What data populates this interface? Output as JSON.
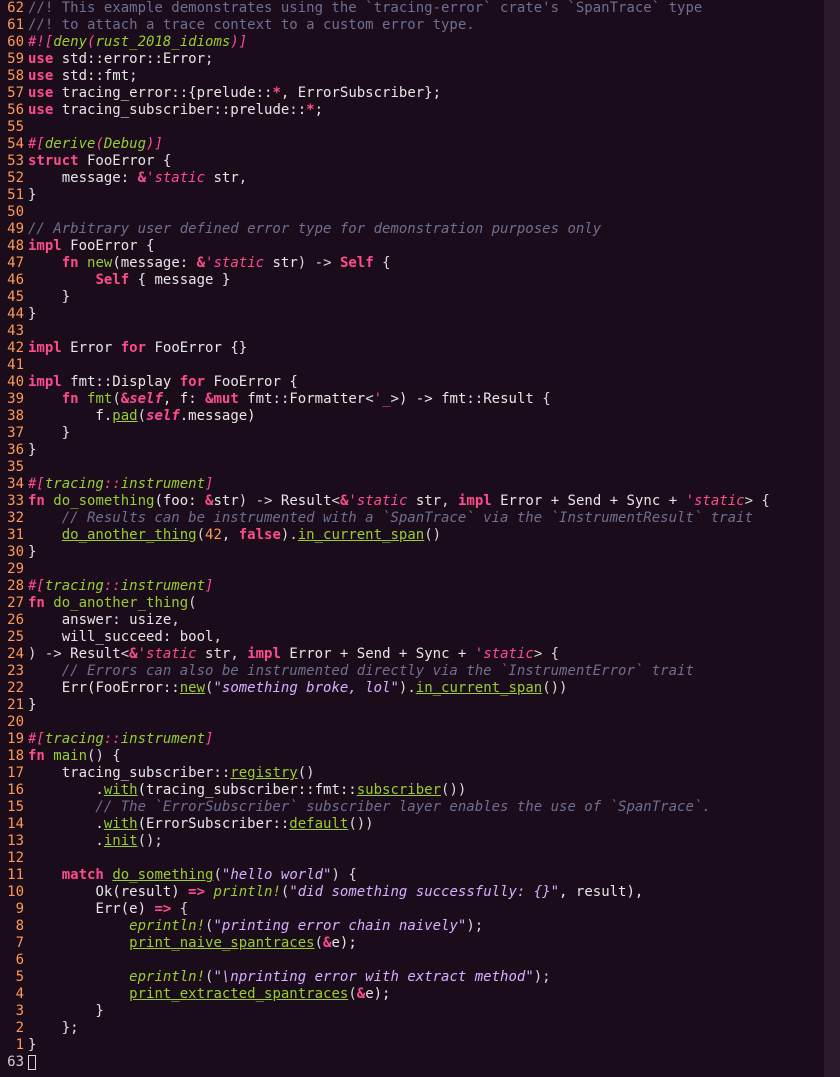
{
  "gutter": {
    "relnums": [
      62,
      61,
      60,
      59,
      58,
      57,
      56,
      55,
      54,
      53,
      52,
      51,
      50,
      49,
      48,
      47,
      46,
      45,
      44,
      43,
      42,
      41,
      40,
      39,
      38,
      37,
      36,
      35,
      34,
      33,
      32,
      31,
      30,
      29,
      28,
      27,
      26,
      25,
      24,
      23,
      22,
      21,
      20,
      19,
      18,
      17,
      16,
      15,
      14,
      13,
      12,
      11,
      10,
      9,
      8,
      7,
      6,
      5,
      4,
      3,
      2,
      1
    ],
    "status": "63"
  },
  "code": {
    "l1": "//! This example demonstrates using the `tracing-error` crate's `SpanTrace` type",
    "l2": "//! to attach a trace context to a custom error type.",
    "l3a": "#![",
    "l3b": "deny",
    "l3c": "(",
    "l3d": "rust_2018_idioms",
    "l3e": ")]",
    "l4a": "use",
    "l4b": " std::error::Error;",
    "l5a": "use",
    "l5b": " std::fmt;",
    "l6a": "use",
    "l6b": " tracing_error::{prelude::",
    "l6c": "*",
    "l6d": ", ErrorSubscriber};",
    "l7a": "use",
    "l7b": " tracing_subscriber::prelude::",
    "l7c": "*",
    "l7d": ";",
    "l9a": "#[",
    "l9b": "derive",
    "l9c": "(",
    "l9d": "Debug",
    "l9e": ")]",
    "l10a": "struct",
    "l10b": " FooError {",
    "l11a": "    message: ",
    "l11b": "&",
    "l11c": "'static",
    "l11d": " str",
    "l11e": ",",
    "l12": "}",
    "l14": "// Arbitrary user defined error type for demonstration purposes only",
    "l15a": "impl",
    "l15b": " FooError {",
    "l16a": "    ",
    "l16b": "fn",
    "l16c": " ",
    "l16d": "new",
    "l16e": "(message: ",
    "l16f": "&",
    "l16g": "'static",
    "l16h": " str",
    "l16i": ") -> ",
    "l16j": "Self",
    "l16k": " {",
    "l17a": "        ",
    "l17b": "Self",
    "l17c": " { message }",
    "l18": "    }",
    "l19": "}",
    "l21a": "impl",
    "l21b": " Error ",
    "l21c": "for",
    "l21d": " FooError {}",
    "l23a": "impl",
    "l23b": " fmt::Display ",
    "l23c": "for",
    "l23d": " FooError {",
    "l24a": "    ",
    "l24b": "fn",
    "l24c": " ",
    "l24d": "fmt",
    "l24e": "(",
    "l24f": "&",
    "l24g": "self",
    "l24h": ", f: ",
    "l24i": "&",
    "l24j": "mut",
    "l24k": " fmt::Formatter<",
    "l24l": "'_",
    "l24m": ">) -> fmt::",
    "l24n": "Result",
    "l24o": " {",
    "l25a": "        f.",
    "l25b": "pad",
    "l25c": "(",
    "l25d": "self",
    "l25e": ".message)",
    "l26": "    }",
    "l27": "}",
    "l29a": "#[",
    "l29b": "tracing",
    "l29c": "::",
    "l29d": "instrument",
    "l29e": "]",
    "l30a": "fn",
    "l30b": " ",
    "l30c": "do_something",
    "l30d": "(foo: ",
    "l30e": "&",
    "l30f": "str",
    "l30g": ") -> ",
    "l30h": "Result",
    "l30i": "<",
    "l30j": "&",
    "l30k": "'static",
    "l30l": " str",
    "l30m": ", ",
    "l30n": "impl",
    "l30o": " Error + Send + Sync + ",
    "l30p": "'static",
    "l30q": "> {",
    "l31": "    // Results can be instrumented with a `SpanTrace` via the `InstrumentResult` trait",
    "l32a": "    ",
    "l32b": "do_another_thing",
    "l32c": "(",
    "l32d": "42",
    "l32e": ", ",
    "l32f": "false",
    "l32g": ").",
    "l32h": "in_current_span",
    "l32i": "()",
    "l33": "}",
    "l35a": "#[",
    "l35b": "tracing",
    "l35c": "::",
    "l35d": "instrument",
    "l35e": "]",
    "l36a": "fn",
    "l36b": " ",
    "l36c": "do_another_thing",
    "l36d": "(",
    "l37a": "    answer: ",
    "l37b": "usize",
    "l37c": ",",
    "l38a": "    will_succeed: ",
    "l38b": "bool",
    "l38c": ",",
    "l39a": ") -> ",
    "l39b": "Result",
    "l39c": "<",
    "l39d": "&",
    "l39e": "'static",
    "l39f": " str",
    "l39g": ", ",
    "l39h": "impl",
    "l39i": " Error + Send + Sync + ",
    "l39j": "'static",
    "l39k": "> {",
    "l40": "    // Errors can also be instrumented directly via the `InstrumentError` trait",
    "l41a": "    ",
    "l41b": "Err",
    "l41c": "(FooError::",
    "l41d": "new",
    "l41e": "(",
    "l41f": "\"something broke, lol\"",
    "l41g": ").",
    "l41h": "in_current_span",
    "l41i": "())",
    "l42": "}",
    "l44a": "#[",
    "l44b": "tracing",
    "l44c": "::",
    "l44d": "instrument",
    "l44e": "]",
    "l45a": "fn",
    "l45b": " ",
    "l45c": "main",
    "l45d": "() {",
    "l46a": "    tracing_subscriber::",
    "l46b": "registry",
    "l46c": "()",
    "l47a": "        .",
    "l47b": "with",
    "l47c": "(tracing_subscriber::fmt::",
    "l47d": "subscriber",
    "l47e": "())",
    "l48": "        // The `ErrorSubscriber` subscriber layer enables the use of `SpanTrace`.",
    "l49a": "        .",
    "l49b": "with",
    "l49c": "(ErrorSubscriber::",
    "l49d": "default",
    "l49e": "())",
    "l50a": "        .",
    "l50b": "init",
    "l50c": "();",
    "l52a": "    ",
    "l52b": "match",
    "l52c": " ",
    "l52d": "do_something",
    "l52e": "(",
    "l52f": "\"hello world\"",
    "l52g": ") {",
    "l53a": "        ",
    "l53b": "Ok",
    "l53c": "(result) ",
    "l53d": "=>",
    "l53e": " ",
    "l53f": "println!",
    "l53g": "(",
    "l53h": "\"did something successfully: {}\"",
    "l53i": ", result),",
    "l54a": "        ",
    "l54b": "Err",
    "l54c": "(e) ",
    "l54d": "=>",
    "l54e": " {",
    "l55a": "            ",
    "l55b": "eprintln!",
    "l55c": "(",
    "l55d": "\"printing error chain naively\"",
    "l55e": ");",
    "l56a": "            ",
    "l56b": "print_naive_spantraces",
    "l56c": "(",
    "l56d": "&",
    "l56e": "e);",
    "l58a": "            ",
    "l58b": "eprintln!",
    "l58c": "(",
    "l58d": "\"\\nprinting error with extract method\"",
    "l58e": ");",
    "l59a": "            ",
    "l59b": "print_extracted_spantraces",
    "l59c": "(",
    "l59d": "&",
    "l59e": "e);",
    "l60": "        }",
    "l61": "    };",
    "l62": "}"
  }
}
